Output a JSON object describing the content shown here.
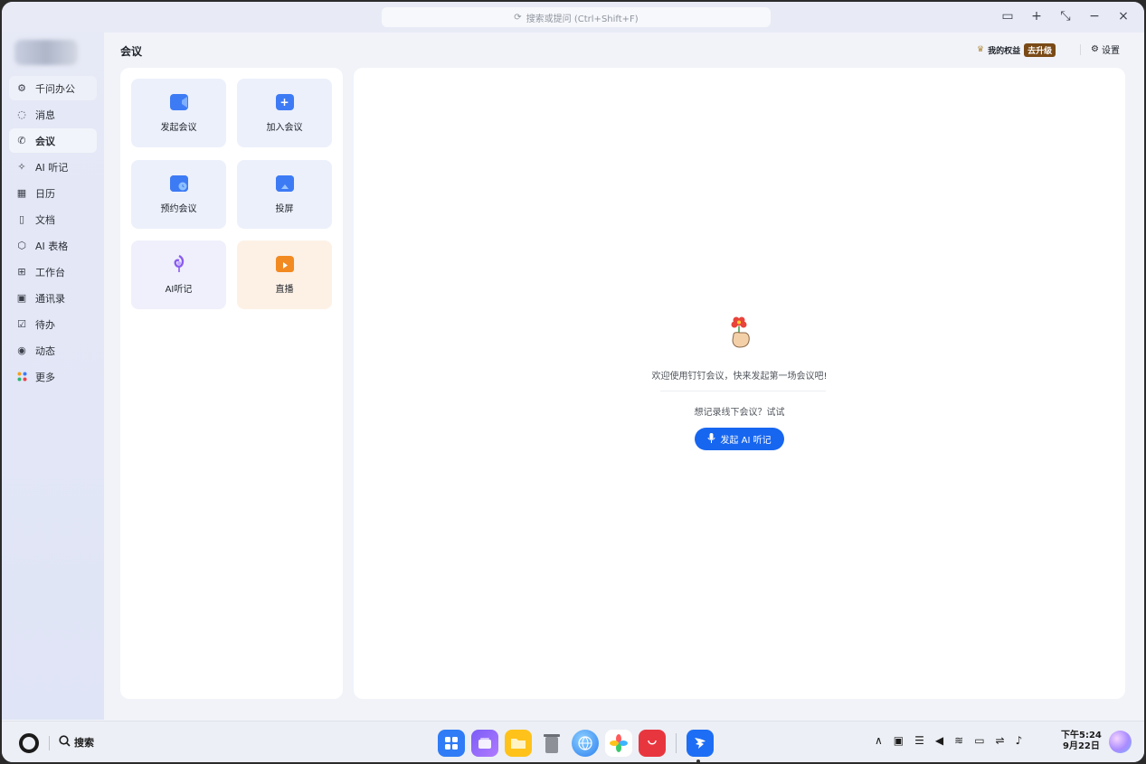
{
  "topbar": {
    "search_placeholder": "搜索或提问 (Ctrl+Shift+F)"
  },
  "sidebar": {
    "items": [
      {
        "label": "千问办公",
        "icon": "gear-sparkle-icon"
      },
      {
        "label": "消息",
        "icon": "chat-icon"
      },
      {
        "label": "会议",
        "icon": "phone-icon"
      },
      {
        "label": "AI 听记",
        "icon": "ai-mic-icon"
      },
      {
        "label": "日历",
        "icon": "calendar-icon"
      },
      {
        "label": "文档",
        "icon": "document-icon"
      },
      {
        "label": "AI 表格",
        "icon": "hexagon-icon"
      },
      {
        "label": "工作台",
        "icon": "grid-icon"
      },
      {
        "label": "通讯录",
        "icon": "contacts-icon"
      },
      {
        "label": "待办",
        "icon": "checkbox-icon"
      },
      {
        "label": "动态",
        "icon": "eye-icon"
      },
      {
        "label": "更多",
        "icon": "dots-icon"
      }
    ]
  },
  "header": {
    "title": "会议",
    "rights_label": "我的权益",
    "upgrade_label": "去升级",
    "settings_label": "设置"
  },
  "tiles": [
    {
      "label": "发起会议",
      "icon": "video-icon",
      "color": "#3d7bf5"
    },
    {
      "label": "加入会议",
      "icon": "plus-icon",
      "color": "#3d7bf5"
    },
    {
      "label": "预约会议",
      "icon": "clock-calendar-icon",
      "color": "#3d7bf5"
    },
    {
      "label": "投屏",
      "icon": "screen-cast-icon",
      "color": "#3d7bf5"
    },
    {
      "label": "AI听记",
      "icon": "ai-mic-icon",
      "color": "#8a5cf0"
    },
    {
      "label": "直播",
      "icon": "tv-play-icon",
      "color": "#f28a22"
    }
  ],
  "main": {
    "welcome_text": "欢迎使用钉钉会议，快来发起第一场会议吧!",
    "hint_text": "想记录线下会议？试试",
    "ai_button_label": "发起 AI 听记"
  },
  "taskbar": {
    "search_label": "搜索",
    "time": "下午5:24",
    "date": "9月22日",
    "apps": [
      "app-grid-icon",
      "multitask-icon",
      "folder-icon",
      "trash-icon",
      "browser-icon",
      "photos-icon",
      "app-gallery-icon",
      "dingtalk-icon"
    ]
  },
  "colors": {
    "accent": "#1766f0",
    "upgrade": "#7a4a16"
  }
}
